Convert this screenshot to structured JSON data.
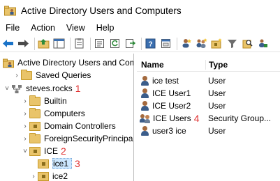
{
  "window": {
    "title": "Active Directory Users and Computers"
  },
  "menu": {
    "items": [
      "File",
      "Action",
      "View",
      "Help"
    ]
  },
  "toolbar": {
    "icons": [
      "back-arrow-icon",
      "forward-arrow-icon",
      "up-folder-icon",
      "show-console-tree-icon",
      "properties-icon",
      "export-list-icon",
      "refresh-icon",
      "export-icon",
      "help-icon",
      "console-icon",
      "new-user-icon",
      "new-group-icon",
      "new-ou-icon",
      "filter-icon",
      "find-icon",
      "add-to-group-icon"
    ]
  },
  "tree": {
    "root": "Active Directory Users and Com",
    "saved_queries": "Saved Queries",
    "domain": "steves.rocks",
    "domain_annot": "1",
    "builtin": "Builtin",
    "computers": "Computers",
    "domain_controllers": "Domain Controllers",
    "foreign": "ForeignSecurityPrincipals",
    "ice": "ICE",
    "ice_annot": "2",
    "ice1": "ice1",
    "ice1_annot": "3",
    "ice2": "ice2"
  },
  "list": {
    "col_name": "Name",
    "col_type": "Type",
    "rows": [
      {
        "name": "ice test",
        "type": "User",
        "icon": "user-icon"
      },
      {
        "name": "ICE User1",
        "type": "User",
        "icon": "user-icon"
      },
      {
        "name": "ICE User2",
        "type": "User",
        "icon": "user-icon"
      },
      {
        "name": "ICE Users",
        "type": "Security Group...",
        "icon": "group-icon",
        "annot": "4"
      },
      {
        "name": "user3 ice",
        "type": "User",
        "icon": "user-icon"
      }
    ]
  },
  "colors": {
    "annotation": "#e03030",
    "selection": "#cde8ff",
    "folder": "#e9c46a"
  }
}
